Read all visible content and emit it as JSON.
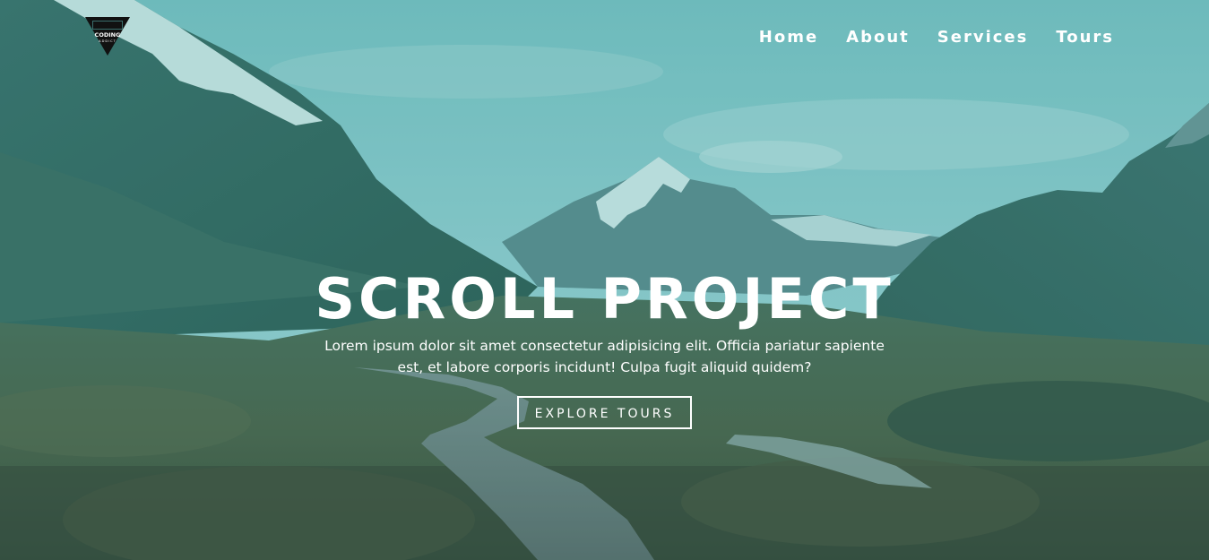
{
  "logo": {
    "icon": "coding-addict-logo-icon",
    "text_line1": "CODING",
    "text_line2": "ADDICT"
  },
  "nav": {
    "items": [
      {
        "label": "Home"
      },
      {
        "label": "About"
      },
      {
        "label": "Services"
      },
      {
        "label": "Tours"
      }
    ]
  },
  "hero": {
    "title": "SCROLL PROJECT",
    "text": "Lorem ipsum dolor sit amet consectetur adipisicing elit. Officia pariatur sapiente est, et labore corporis incidunt! Culpa fugit aliquid quidem?",
    "button_label": "EXPLORE TOURS",
    "background": "mountain-valley-boardwalk-photo",
    "overlay_color": "#2a9696"
  }
}
